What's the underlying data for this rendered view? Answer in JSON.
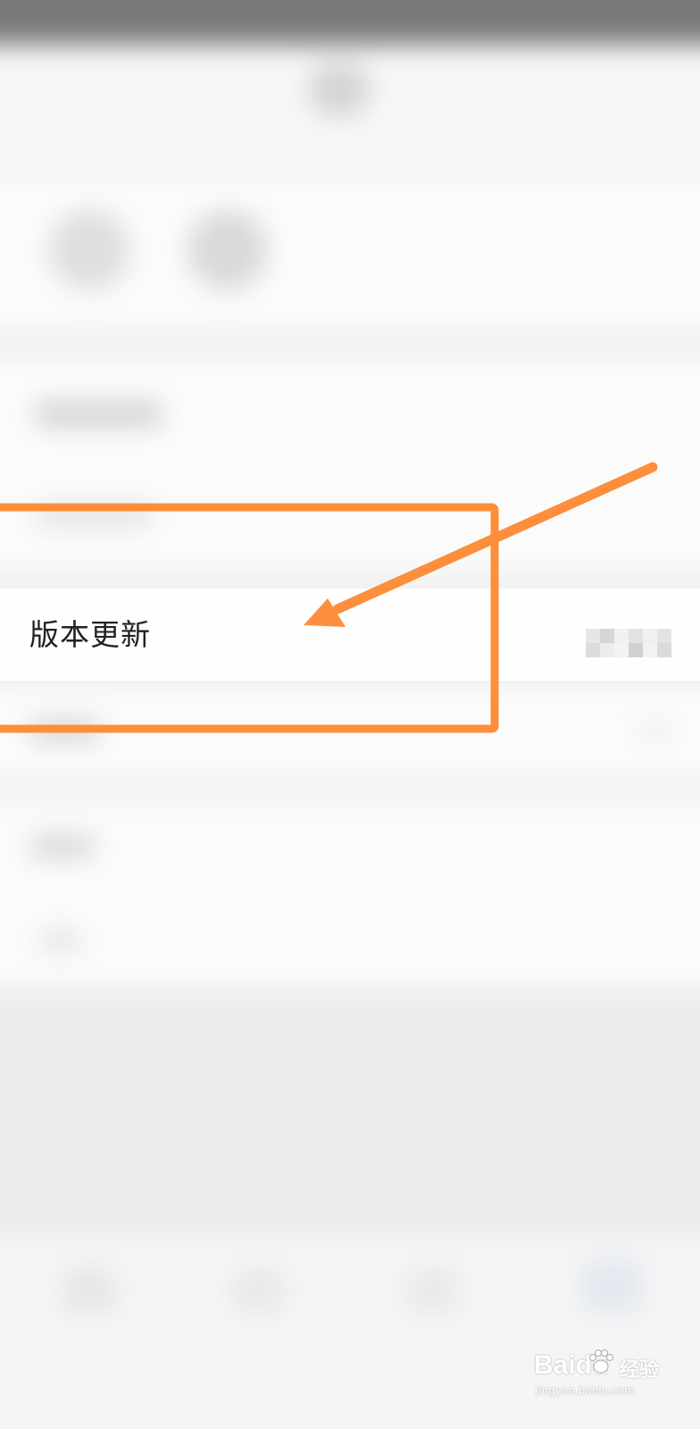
{
  "settings_row": {
    "label": "版本更新"
  },
  "annotation": {
    "color": "#fd8e3c"
  },
  "watermark": {
    "logo_text": "Baidu",
    "brand_cn": "经验",
    "url": "jingyan.baidu.com"
  }
}
